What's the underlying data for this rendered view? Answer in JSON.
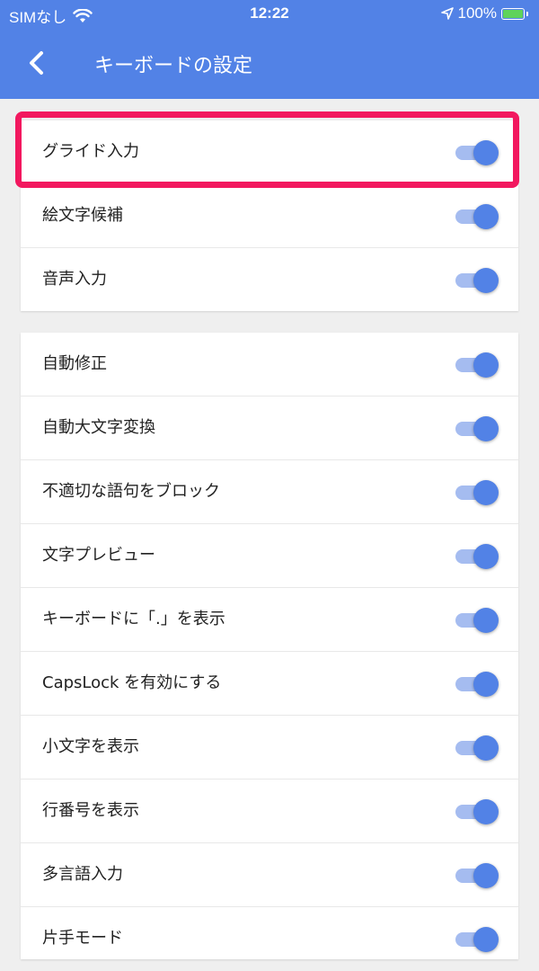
{
  "status_bar": {
    "carrier": "SIMなし",
    "time": "12:22",
    "battery_percent": "100%"
  },
  "nav": {
    "title": "キーボードの設定"
  },
  "colors": {
    "header": "#5282e6",
    "toggle_on": "#5282e6",
    "highlight": "#f2185f"
  },
  "group1": [
    {
      "label": "グライド入力",
      "enabled": true
    },
    {
      "label": "絵文字候補",
      "enabled": true
    },
    {
      "label": "音声入力",
      "enabled": true
    }
  ],
  "group2": [
    {
      "label": "自動修正",
      "enabled": true
    },
    {
      "label": "自動大文字変換",
      "enabled": true
    },
    {
      "label": "不適切な語句をブロック",
      "enabled": true
    },
    {
      "label": "文字プレビュー",
      "enabled": true
    },
    {
      "label": "キーボードに「.」を表示",
      "enabled": true
    },
    {
      "label": "CapsLock を有効にする",
      "enabled": true
    },
    {
      "label": "小文字を表示",
      "enabled": true
    },
    {
      "label": "行番号を表示",
      "enabled": true
    },
    {
      "label": "多言語入力",
      "enabled": true
    },
    {
      "label": "片手モード",
      "enabled": true
    }
  ]
}
